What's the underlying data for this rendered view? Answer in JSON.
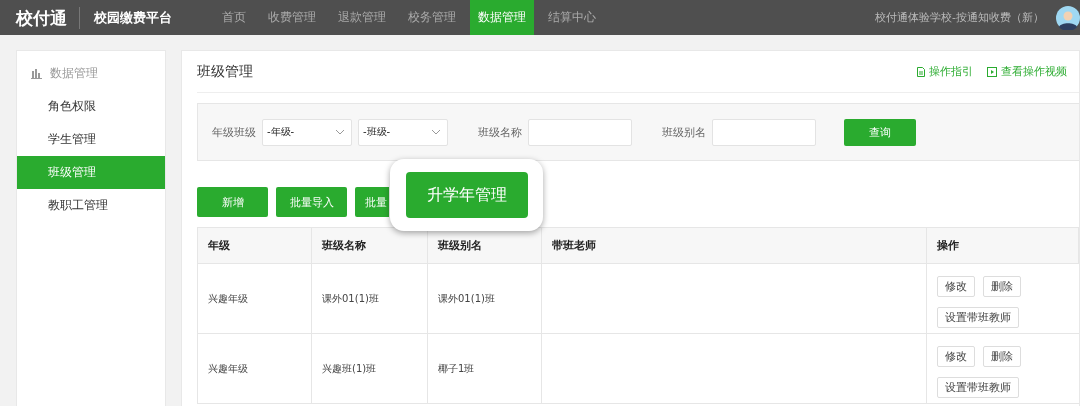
{
  "header": {
    "logo": "校付通",
    "platform": "校园缴费平台",
    "nav": [
      {
        "label": "首页",
        "selected": false
      },
      {
        "label": "收费管理",
        "selected": false
      },
      {
        "label": "退款管理",
        "selected": false
      },
      {
        "label": "校务管理",
        "selected": false
      },
      {
        "label": "数据管理",
        "selected": true
      },
      {
        "label": "结算中心",
        "selected": false
      }
    ],
    "school": "校付通体验学校-按通知收费（新）"
  },
  "sidebar": {
    "title": "数据管理",
    "items": [
      {
        "label": "角色权限",
        "selected": false
      },
      {
        "label": "学生管理",
        "selected": false
      },
      {
        "label": "班级管理",
        "selected": true
      },
      {
        "label": "教职工管理",
        "selected": false
      }
    ]
  },
  "page": {
    "title": "班级管理",
    "links": [
      {
        "kind": "doc",
        "label": "操作指引"
      },
      {
        "kind": "video",
        "label": "查看操作视频"
      }
    ]
  },
  "filters": {
    "grade_class_label": "年级班级",
    "grade_select": "-年级-",
    "class_select": "-班级-",
    "class_name_label": "班级名称",
    "class_alias_label": "班级别名",
    "query_button": "查询"
  },
  "actions": [
    "新增",
    "批量导入",
    "批量"
  ],
  "callout": {
    "label": "升学年管理"
  },
  "table": {
    "columns": [
      "年级",
      "班级名称",
      "班级别名",
      "带班老师",
      "操作"
    ],
    "rows": [
      {
        "cells": [
          "兴趣年级",
          "课外01(1)班",
          "课外01(1)班",
          ""
        ],
        "edit": "修改",
        "delete": "删除",
        "set_teacher": "设置带班教师"
      },
      {
        "cells": [
          "兴趣年级",
          "兴趣班(1)班",
          "椰子1班",
          ""
        ],
        "edit": "修改",
        "delete": "删除",
        "set_teacher": "设置带班教师"
      }
    ]
  }
}
